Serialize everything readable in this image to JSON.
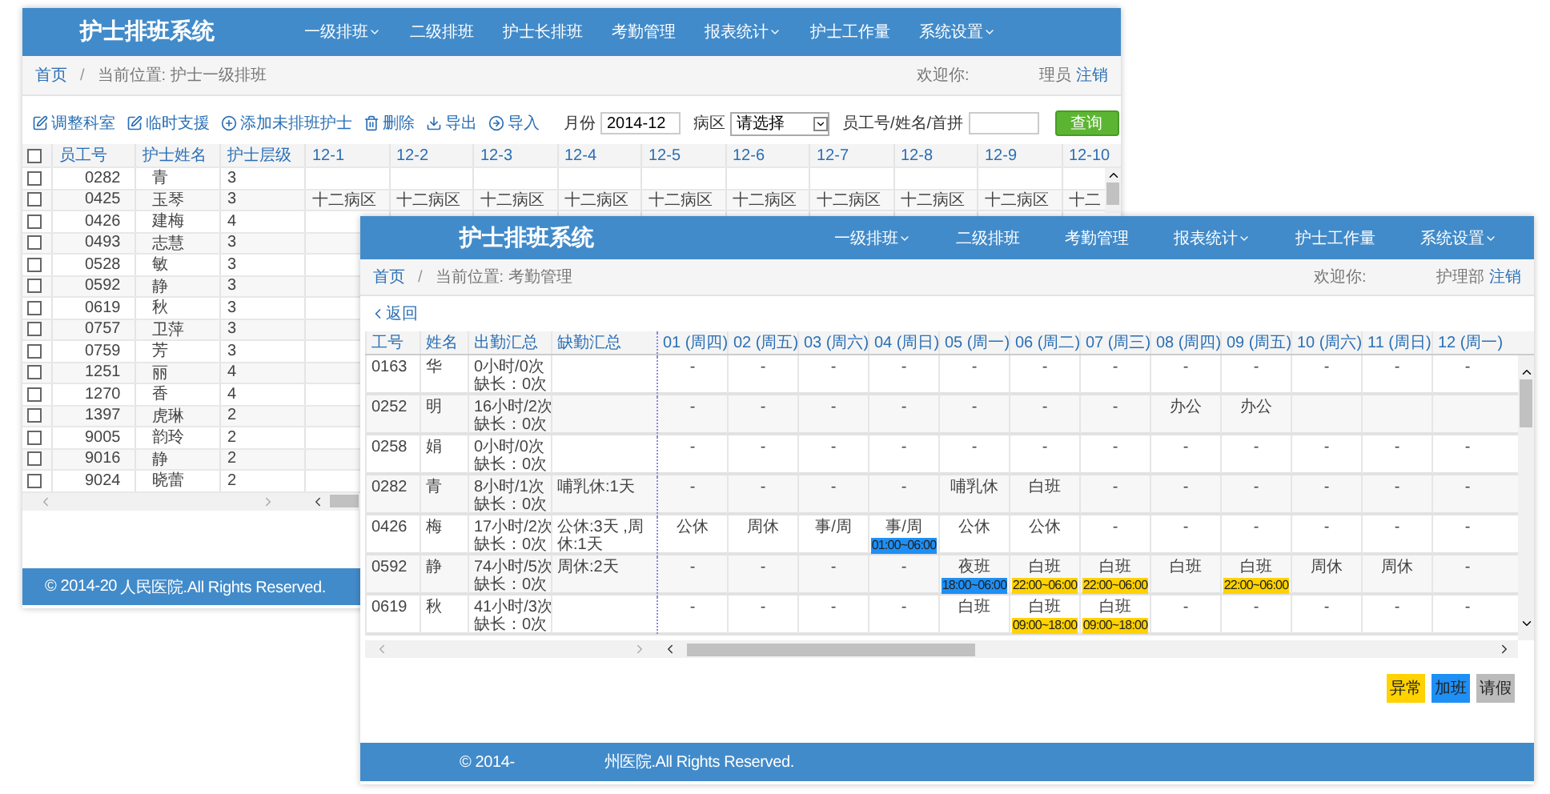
{
  "back_window": {
    "title": "护士排班系统",
    "nav": [
      {
        "label": "一级排班",
        "dropdown": true
      },
      {
        "label": "二级排班",
        "dropdown": false
      },
      {
        "label": "护士长排班",
        "dropdown": false
      },
      {
        "label": "考勤管理",
        "dropdown": false
      },
      {
        "label": "报表统计",
        "dropdown": true
      },
      {
        "label": "护士工作量",
        "dropdown": false
      },
      {
        "label": "系统设置",
        "dropdown": true
      }
    ],
    "breadcrumb": {
      "home": "首页",
      "separator": "/",
      "location": "当前位置: 护士一级排班"
    },
    "user": {
      "greeting": "欢迎你:",
      "name": "理员",
      "logout": "注销"
    },
    "toolbar": [
      {
        "kind": "edit",
        "label": "调整科室"
      },
      {
        "kind": "edit",
        "label": "临时支援"
      },
      {
        "kind": "add",
        "label": "添加未排班护士"
      },
      {
        "kind": "delete",
        "label": "删除"
      },
      {
        "kind": "export",
        "label": "导出"
      },
      {
        "kind": "import",
        "label": "导入"
      }
    ],
    "filters": {
      "month_label": "月份",
      "month_value": "2014-12",
      "ward_label": "病区",
      "ward_value": "请选择",
      "search_label": "员工号/姓名/首拼"
    },
    "search_button": "查询",
    "table": {
      "all_checked": false,
      "columns": [
        "员工号",
        "护士姓名",
        "护士层级",
        "12-1",
        "12-2",
        "12-3",
        "12-4",
        "12-5",
        "12-6",
        "12-7",
        "12-8",
        "12-9",
        "12-10"
      ],
      "rows": [
        {
          "checked": false,
          "id": "0282",
          "name": "青",
          "level": "3"
        },
        {
          "checked": false,
          "id": "0425",
          "name": "玉琴",
          "level": "3",
          "days": [
            "十二病区",
            "十二病区",
            "十二病区",
            "十二病区",
            "十二病区",
            "十二病区",
            "十二病区",
            "十二病区",
            "十二病区",
            "十二"
          ]
        },
        {
          "checked": false,
          "id": "0426",
          "name": "建梅",
          "level": "4"
        },
        {
          "checked": false,
          "id": "0493",
          "name": "志慧",
          "level": "3"
        },
        {
          "checked": false,
          "id": "0528",
          "name": "敏",
          "level": "3"
        },
        {
          "checked": false,
          "id": "0592",
          "name": "静",
          "level": "3"
        },
        {
          "checked": false,
          "id": "0619",
          "name": "秋",
          "level": "3"
        },
        {
          "checked": false,
          "id": "0757",
          "name": "卫萍",
          "level": "3"
        },
        {
          "checked": false,
          "id": "0759",
          "name": "芳",
          "level": "3"
        },
        {
          "checked": false,
          "id": "1251",
          "name": "丽",
          "level": "4"
        },
        {
          "checked": false,
          "id": "1270",
          "name": "香",
          "level": "4"
        },
        {
          "checked": false,
          "id": "1397",
          "name": "虎琳",
          "level": "2"
        },
        {
          "checked": false,
          "id": "9005",
          "name": "韵玲",
          "level": "2"
        },
        {
          "checked": false,
          "id": "9016",
          "name": "静",
          "level": "2"
        },
        {
          "checked": false,
          "id": "9024",
          "name": "晓蕾",
          "level": "2"
        }
      ]
    },
    "footer": [
      "© 2014-20",
      "人民医院.All Rights Reserved."
    ]
  },
  "front_window": {
    "title": "护士排班系统",
    "nav": [
      {
        "label": "一级排班",
        "dropdown": true
      },
      {
        "label": "二级排班",
        "dropdown": false
      },
      {
        "label": "考勤管理",
        "dropdown": false
      },
      {
        "label": "报表统计",
        "dropdown": true
      },
      {
        "label": "护士工作量",
        "dropdown": false
      },
      {
        "label": "系统设置",
        "dropdown": true
      }
    ],
    "breadcrumb": {
      "home": "首页",
      "separator": "/",
      "location": "当前位置: 考勤管理"
    },
    "user": {
      "greeting": "欢迎你:",
      "name": "护理部",
      "logout": "注销"
    },
    "back_link": "返回",
    "table": {
      "columns": [
        "工号",
        "姓名",
        "出勤汇总",
        "缺勤汇总"
      ],
      "days": [
        "01 (周四)",
        "02 (周五)",
        "03 (周六)",
        "04 (周日)",
        "05 (周一)",
        "06 (周二)",
        "07 (周三)",
        "08 (周四)",
        "09 (周五)",
        "10 (周六)",
        "11 (周日)",
        "12 (周一)"
      ],
      "rows": [
        {
          "id": "0163",
          "name": "华",
          "attendance": [
            "0小时/0次",
            "缺长：0次"
          ],
          "days": [
            {
              "text": "-"
            },
            {
              "text": "-"
            },
            {
              "text": "-"
            },
            {
              "text": "-"
            },
            {
              "text": "-"
            },
            {
              "text": "-"
            },
            {
              "text": "-"
            },
            {
              "text": "-"
            },
            {
              "text": "-"
            },
            {
              "text": "-"
            },
            {
              "text": "-"
            },
            {
              "text": "-"
            }
          ]
        },
        {
          "id": "0252",
          "name": "明",
          "attendance": [
            "16小时/2次",
            "缺长：0次"
          ],
          "days": [
            {
              "text": "-"
            },
            {
              "text": "-"
            },
            {
              "text": "-"
            },
            {
              "text": "-"
            },
            {
              "text": "-"
            },
            {
              "text": "-"
            },
            {
              "text": "-"
            },
            {
              "text": "办公"
            },
            {
              "text": "办公"
            }
          ]
        },
        {
          "id": "0258",
          "name": "娟",
          "attendance": [
            "0小时/0次",
            "缺长：0次"
          ],
          "days": [
            {
              "text": "-"
            },
            {
              "text": "-"
            },
            {
              "text": "-"
            },
            {
              "text": "-"
            },
            {
              "text": "-"
            },
            {
              "text": "-"
            },
            {
              "text": "-"
            },
            {
              "text": "-"
            },
            {
              "text": "-"
            },
            {
              "text": "-"
            },
            {
              "text": "-"
            },
            {
              "text": "-"
            }
          ]
        },
        {
          "id": "0282",
          "name": "青",
          "attendance": [
            "8小时/1次",
            "缺长：0次"
          ],
          "absence": "哺乳休:1天",
          "days": [
            {
              "text": "-"
            },
            {
              "text": "-"
            },
            {
              "text": "-"
            },
            {
              "text": "-"
            },
            {
              "text": "哺乳休"
            },
            {
              "text": "白班"
            },
            {
              "text": "-"
            },
            {
              "text": "-"
            },
            {
              "text": "-"
            },
            {
              "text": "-"
            },
            {
              "text": "-"
            },
            {
              "text": "-"
            }
          ]
        },
        {
          "id": "0426",
          "name": "梅",
          "attendance": [
            "17小时/2次",
            "缺长：0次"
          ],
          "absence": "公休:3天 ,周休:1天",
          "days": [
            {
              "text": "公休"
            },
            {
              "text": "周休"
            },
            {
              "text": "事/周"
            },
            {
              "text": "事/周",
              "time": {
                "text": "01:00~06:00",
                "color": "#1e8ff5"
              }
            },
            {
              "text": "公休"
            },
            {
              "text": "公休"
            },
            {
              "text": "-"
            },
            {
              "text": "-"
            },
            {
              "text": "-"
            },
            {
              "text": "-"
            },
            {
              "text": "-"
            },
            {
              "text": "-"
            }
          ]
        },
        {
          "id": "0592",
          "name": "静",
          "attendance": [
            "74小时/5次",
            "缺长：0次"
          ],
          "absence": "周休:2天",
          "days": [
            {
              "text": "-"
            },
            {
              "text": "-"
            },
            {
              "text": "-"
            },
            {
              "text": "-"
            },
            {
              "text": "夜班",
              "time": {
                "text": "18:00~06:00",
                "color": "#1e8ff5"
              }
            },
            {
              "text": "白班",
              "time": {
                "text": "22:00~06:00",
                "color": "#ffd200"
              }
            },
            {
              "text": "白班",
              "time": {
                "text": "22:00~06:00",
                "color": "#ffd200"
              }
            },
            {
              "text": "白班"
            },
            {
              "text": "白班",
              "time": {
                "text": "22:00~06:00",
                "color": "#ffd200"
              }
            },
            {
              "text": "周休"
            },
            {
              "text": "周休"
            },
            {
              "text": "-"
            }
          ]
        },
        {
          "id": "0619",
          "name": "秋",
          "attendance": [
            "41小时/3次",
            "缺长：0次"
          ],
          "days": [
            {
              "text": "-"
            },
            {
              "text": "-"
            },
            {
              "text": "-"
            },
            {
              "text": "-"
            },
            {
              "text": "白班"
            },
            {
              "text": "白班",
              "time": {
                "text": "09:00~18:00",
                "color": "#ffd200"
              }
            },
            {
              "text": "白班",
              "time": {
                "text": "09:00~18:00",
                "color": "#ffd200"
              }
            },
            {
              "text": "-"
            },
            {
              "text": "-"
            },
            {
              "text": "-"
            },
            {
              "text": "-"
            },
            {
              "text": "-"
            }
          ]
        }
      ]
    },
    "legend": [
      {
        "label": "异常",
        "color": "#ffd200"
      },
      {
        "label": "加班",
        "color": "#1e8ff5"
      },
      {
        "label": "请假",
        "color": "#bbbbbb"
      }
    ],
    "footer": [
      "© 2014-",
      "州医院.All Rights Reserved."
    ]
  }
}
